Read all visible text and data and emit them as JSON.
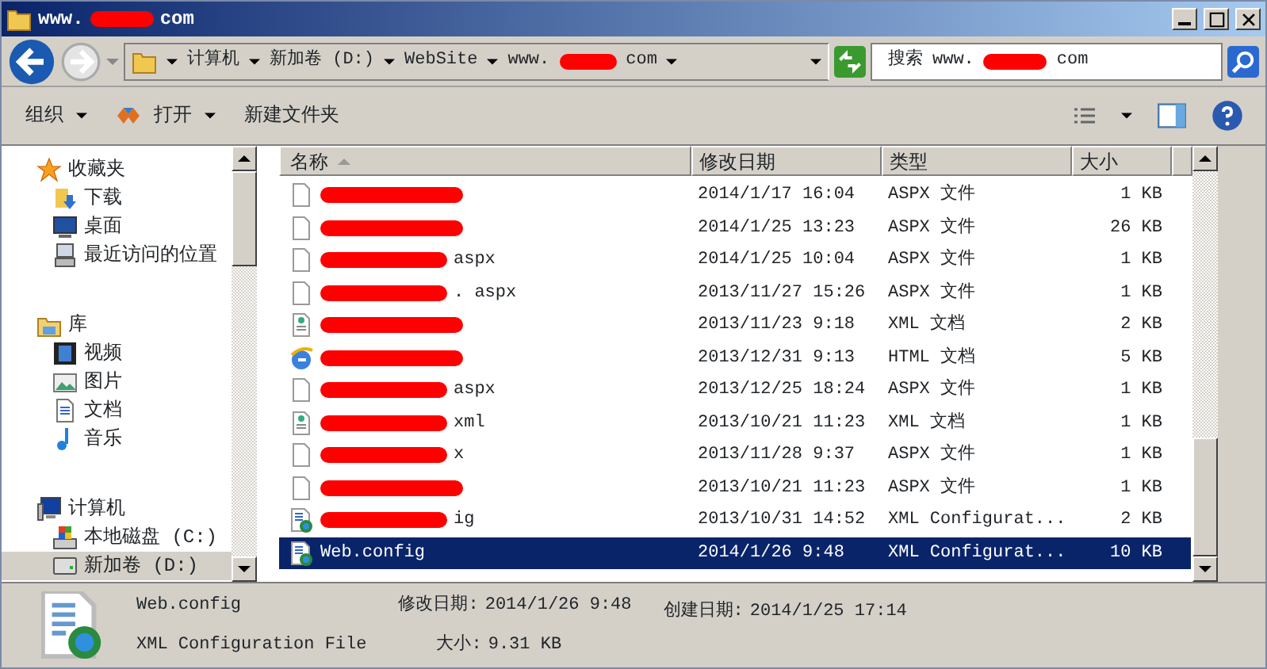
{
  "window": {
    "title_prefix": "www.",
    "title_suffix": "com",
    "title_redacted": true
  },
  "address": {
    "crumbs": [
      {
        "text": "计算机"
      },
      {
        "text": "新加卷 (D:)"
      },
      {
        "text": "WebSite"
      },
      {
        "text": "www.",
        "redacted": true,
        "suffix": "com"
      }
    ]
  },
  "search": {
    "label": "搜索",
    "prefix": "www.",
    "redacted": true,
    "suffix": "com"
  },
  "toolbar": {
    "organize": "组织",
    "open": "打开",
    "new_folder": "新建文件夹"
  },
  "sidebar": {
    "items": [
      {
        "label": "收藏夹",
        "children": [
          {
            "label": "下载",
            "selected": false
          },
          {
            "label": "桌面",
            "selected": false
          },
          {
            "label": "最近访问的位置",
            "selected": false
          }
        ]
      },
      {
        "label": "库",
        "children": [
          {
            "label": "视频",
            "selected": false
          },
          {
            "label": "图片",
            "selected": false
          },
          {
            "label": "文档",
            "selected": false
          },
          {
            "label": "音乐",
            "selected": false
          }
        ]
      },
      {
        "label": "计算机",
        "children": [
          {
            "label": "本地磁盘 (C:)",
            "selected": false
          },
          {
            "label": "新加卷 (D:)",
            "selected": true
          }
        ]
      }
    ]
  },
  "table": {
    "columns": [
      "名称",
      "修改日期",
      "类型",
      "大小"
    ],
    "rows": [
      {
        "kind": "page",
        "redacted": true,
        "date": "2014/1/17 16:04",
        "type": "ASPX 文件",
        "size": "1 KB",
        "selected": false
      },
      {
        "kind": "page",
        "redacted": true,
        "date": "2014/1/25 13:23",
        "type": "ASPX 文件",
        "size": "26 KB",
        "selected": false
      },
      {
        "kind": "page",
        "redacted": true,
        "name": "aspx",
        "date": "2014/1/25 10:04",
        "type": "ASPX 文件",
        "size": "1 KB",
        "selected": false
      },
      {
        "kind": "page",
        "redacted": true,
        "name": ". aspx",
        "date": "2013/11/27 15:26",
        "type": "ASPX 文件",
        "size": "1 KB",
        "selected": false
      },
      {
        "kind": "xml",
        "redacted": true,
        "date": "2013/11/23 9:18",
        "type": "XML 文档",
        "size": "2 KB",
        "selected": false
      },
      {
        "kind": "html",
        "redacted": true,
        "date": "2013/12/31 9:13",
        "type": "HTML 文档",
        "size": "5 KB",
        "selected": false
      },
      {
        "kind": "page",
        "redacted": true,
        "name": "aspx",
        "date": "2013/12/25 18:24",
        "type": "ASPX 文件",
        "size": "1 KB",
        "selected": false
      },
      {
        "kind": "xml",
        "redacted": true,
        "name": "xml",
        "date": "2013/10/21 11:23",
        "type": "XML 文档",
        "size": "1 KB",
        "selected": false
      },
      {
        "kind": "page",
        "redacted": true,
        "name": "x",
        "date": "2013/11/28 9:37",
        "type": "ASPX 文件",
        "size": "1 KB",
        "selected": false
      },
      {
        "kind": "page",
        "redacted": true,
        "date": "2013/10/21 11:23",
        "type": "ASPX 文件",
        "size": "1 KB",
        "selected": false
      },
      {
        "kind": "config",
        "redacted": true,
        "name": "ig",
        "date": "2013/10/31 14:52",
        "type": "XML Configurat...",
        "size": "2 KB",
        "selected": false
      },
      {
        "kind": "config",
        "redacted": false,
        "name": "Web.config",
        "date": "2014/1/26 9:48",
        "type": "XML Configurat...",
        "size": "10 KB",
        "selected": true
      }
    ]
  },
  "details": {
    "name": "Web.config",
    "type": "XML Configuration File",
    "modified_label": "修改日期:",
    "modified": "2014/1/26 9:48",
    "created_label": "创建日期:",
    "created": "2014/1/25 17:14",
    "size_label": "大小:",
    "size": "9.31 KB"
  }
}
